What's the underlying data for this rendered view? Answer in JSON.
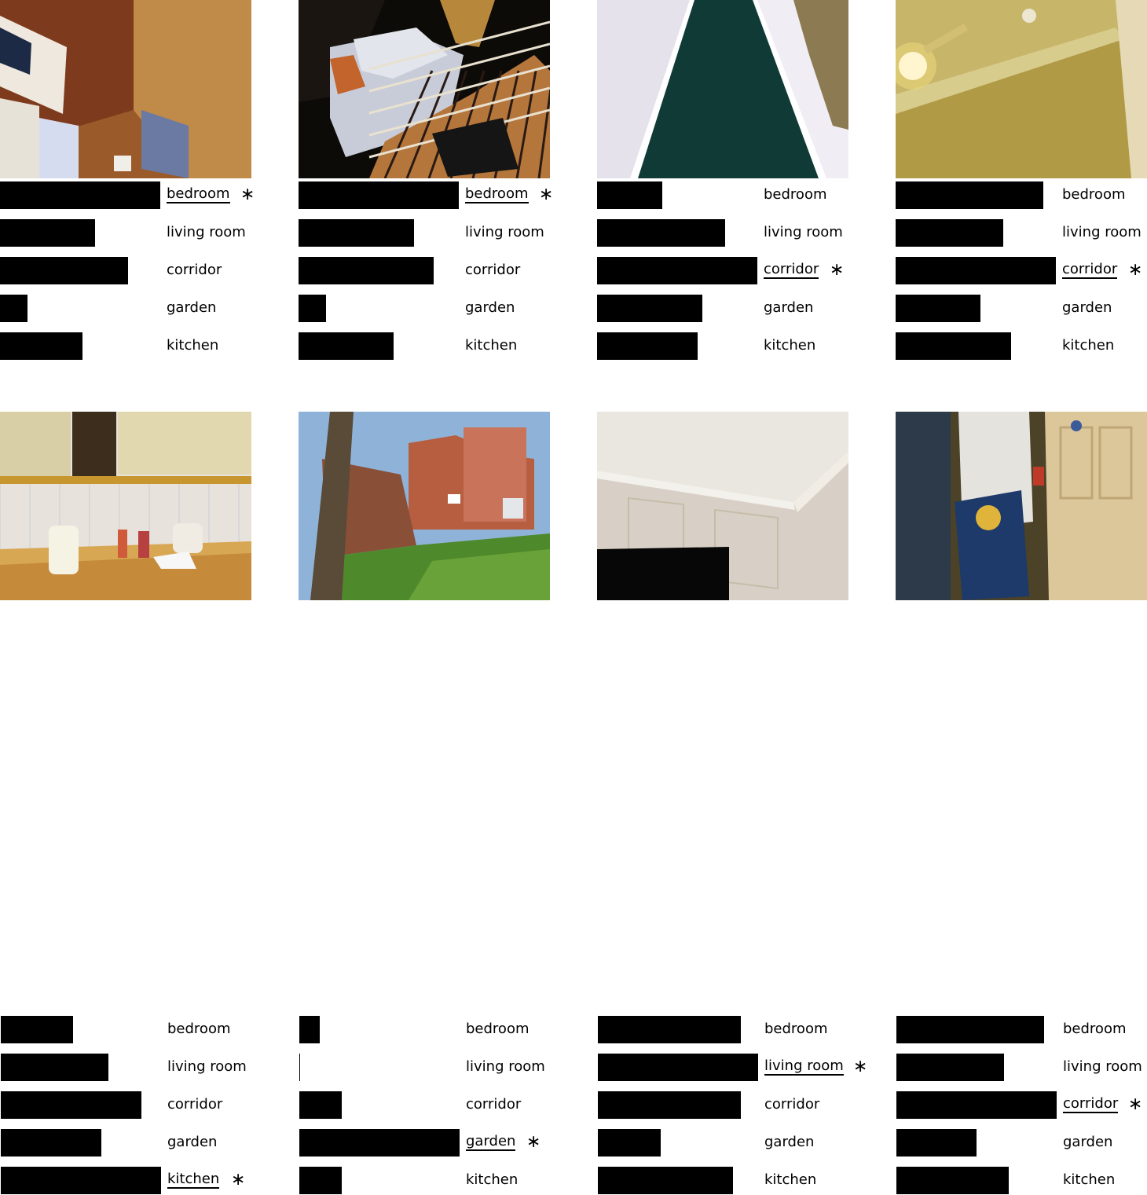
{
  "chart_data": [
    {
      "type": "bar",
      "orientation": "horizontal",
      "image": "bedroom-noticeboard",
      "categories": [
        "bedroom",
        "living room",
        "corridor",
        "garden",
        "kitchen"
      ],
      "values": [
        0.64,
        0.38,
        0.51,
        0.11,
        0.33
      ],
      "predicted": "bedroom",
      "marker": "∗"
    },
    {
      "type": "bar",
      "orientation": "horizontal",
      "image": "bed-with-plaid-blanket",
      "categories": [
        "bedroom",
        "living room",
        "corridor",
        "garden",
        "kitchen"
      ],
      "values": [
        0.64,
        0.46,
        0.54,
        0.11,
        0.38
      ],
      "predicted": "bedroom",
      "marker": "∗"
    },
    {
      "type": "bar",
      "orientation": "horizontal",
      "image": "corridor-green-carpet",
      "categories": [
        "bedroom",
        "living room",
        "corridor",
        "garden",
        "kitchen"
      ],
      "values": [
        0.26,
        0.51,
        0.64,
        0.42,
        0.4
      ],
      "predicted": "corridor",
      "marker": "∗"
    },
    {
      "type": "bar",
      "orientation": "horizontal",
      "image": "ceiling-light",
      "categories": [
        "bedroom",
        "living room",
        "corridor",
        "garden",
        "kitchen"
      ],
      "values": [
        0.59,
        0.43,
        0.64,
        0.34,
        0.46
      ],
      "predicted": "corridor",
      "marker": "∗"
    },
    {
      "type": "bar",
      "orientation": "horizontal",
      "image": "kitchen-counter-kettle",
      "categories": [
        "bedroom",
        "living room",
        "corridor",
        "garden",
        "kitchen"
      ],
      "values": [
        0.29,
        0.43,
        0.56,
        0.4,
        0.64
      ],
      "predicted": "kitchen",
      "marker": "∗"
    },
    {
      "type": "bar",
      "orientation": "horizontal",
      "image": "garden-lawn-houses",
      "categories": [
        "bedroom",
        "living room",
        "corridor",
        "garden",
        "kitchen"
      ],
      "values": [
        0.08,
        0.003,
        0.17,
        0.64,
        0.17
      ],
      "predicted": "garden",
      "marker": "∗"
    },
    {
      "type": "bar",
      "orientation": "horizontal",
      "image": "living-room-ceiling-tv",
      "categories": [
        "bedroom",
        "living room",
        "corridor",
        "garden",
        "kitchen"
      ],
      "values": [
        0.57,
        0.64,
        0.57,
        0.25,
        0.54
      ],
      "predicted": "living room",
      "marker": "∗"
    },
    {
      "type": "bar",
      "orientation": "horizontal",
      "image": "corridor-fire-notice-door",
      "categories": [
        "bedroom",
        "living room",
        "corridor",
        "garden",
        "kitchen"
      ],
      "values": [
        0.59,
        0.43,
        0.64,
        0.32,
        0.45
      ],
      "predicted": "corridor",
      "marker": "∗"
    }
  ]
}
